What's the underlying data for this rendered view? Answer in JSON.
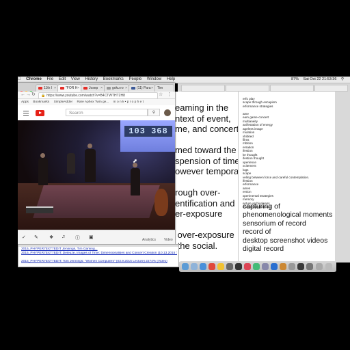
{
  "menubar": {
    "apple": "",
    "app_name": "Chrome",
    "items": [
      "File",
      "Edit",
      "View",
      "History",
      "Bookmarks",
      "People",
      "Window",
      "Help"
    ],
    "clock": "Sat Oct 22 21:53:36",
    "battery": "87%"
  },
  "chrome": {
    "tabs": [
      {
        "label": "11th I"
      },
      {
        "label": "\"FOR H"
      },
      {
        "label": "Josep"
      },
      {
        "label": "goku ro"
      },
      {
        "label": "(11) Para"
      },
      {
        "label": "Tim"
      }
    ],
    "url": "https://www.youtube.com/watch?v=B4CTWTHT2H8",
    "bookmarks": [
      "Apps",
      "Bookmarks",
      "SimpleAdder",
      "Rare Aphex Twin ge...",
      "m o n k • p r o p h e t"
    ],
    "youtube": {
      "search_placeholder": "Search",
      "scoreboard_left": "103",
      "scoreboard_right": "368"
    },
    "controls": {
      "analytics": "Analytics",
      "video": "Video"
    }
  },
  "middle_text": {
    "lines": [
      "eaming in the",
      "ntext of event,",
      "me, and concert.",
      "",
      "med toward the",
      "spension of time,",
      "owever temporary,",
      "",
      "rough over-",
      "entification and",
      "er-exposure",
      "",
      " over-exposure",
      " the social."
    ]
  },
  "notes": {
    "small_lines": [
      "erfo play",
      "scape through escapism",
      "erformance strategies",
      "",
      "ame",
      "eam game-concert",
      "multianeity",
      "anifestation of energy",
      "ageless image",
      "mulation",
      "xhibited",
      "films",
      "mbition",
      "ersation",
      "ifestion",
      "ke thought",
      "ifestion thought",
      "xperience",
      "xcitement",
      "logs",
      "scape",
      "veling between force and careful contemplation.",
      "ifestion",
      "erformance",
      "ames",
      "ersion",
      "xperimental strategies",
      "memory",
      "esture archivalness",
      "elosites (aabuntbas))"
    ],
    "large_lines": [
      "capturing of",
      "phenomenological moments",
      "sensorium of record",
      "record of",
      "desktop screenshot videos",
      "digital record"
    ]
  },
  "bottom_links": [
    "2015_PHYPER7EXT7EDIT Jennings, Tim Gaming...",
    "2015_PHYPER7EXT7EDIT: Deleuze, Images of Time: Dimensionalities and Concert Creation (10.13.2015 ?)(doc)",
    "2015_PHYPER7EXT7EDIT: Tom Jennings: \"Women Computers\" (03.9.2015 Lecture) 2274% (Video)"
  ],
  "colors": {
    "youtube_red": "#e62117",
    "link_blue": "#1a2fb8",
    "menubar_bg": "#e9e9e9"
  }
}
